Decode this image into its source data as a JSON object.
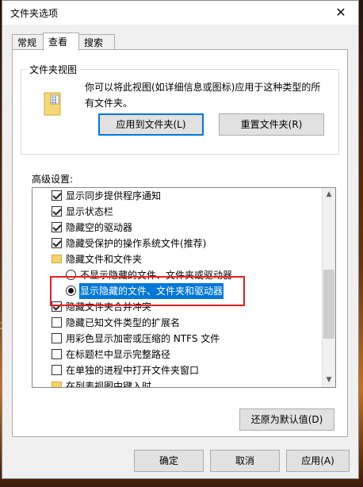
{
  "background": {
    "fragment": "2"
  },
  "window": {
    "title": "文件夹选项",
    "close_label": "✕"
  },
  "tabs": [
    {
      "label": "常规"
    },
    {
      "label": "查看"
    },
    {
      "label": "搜索"
    }
  ],
  "folder_views": {
    "group_label": "文件夹视图",
    "description": "你可以将此视图(如详细信息或图标)应用于这种类型的所有文件夹。",
    "apply_button": "应用到文件夹(L)",
    "reset_button": "重置文件夹(R)"
  },
  "advanced": {
    "label": "高级设置:",
    "items": [
      {
        "kind": "checkbox",
        "label": "显示同步提供程序通知",
        "checked": true
      },
      {
        "kind": "checkbox",
        "label": "显示状态栏",
        "checked": true
      },
      {
        "kind": "checkbox",
        "label": "隐藏空的驱动器",
        "checked": true
      },
      {
        "kind": "checkbox",
        "label": "隐藏受保护的操作系统文件(推荐)",
        "checked": true
      },
      {
        "kind": "folder",
        "label": "隐藏文件和文件夹"
      },
      {
        "kind": "radio",
        "label": "不显示隐藏的文件、文件夹或驱动器",
        "selected": false
      },
      {
        "kind": "radio",
        "label": "显示隐藏的文件、文件夹和驱动器",
        "selected": true
      },
      {
        "kind": "checkbox",
        "label": "隐藏文件夹合并冲突",
        "checked": true
      },
      {
        "kind": "checkbox",
        "label": "隐藏已知文件类型的扩展名",
        "checked": false
      },
      {
        "kind": "checkbox",
        "label": "用彩色显示加密或压缩的 NTFS 文件",
        "checked": false
      },
      {
        "kind": "checkbox",
        "label": "在标题栏中显示完整路径",
        "checked": false
      },
      {
        "kind": "checkbox",
        "label": "在单独的进程中打开文件夹窗口",
        "checked": false
      },
      {
        "kind": "folder",
        "label": "在列表视图中键入时"
      }
    ],
    "restore_defaults_button": "还原为默认值(D)"
  },
  "footer": {
    "ok": "确定",
    "cancel": "取消",
    "apply": "应用(A)"
  },
  "colors": {
    "selection": "#0078d7",
    "annotation": "#e81c1c",
    "focus_border": "#0078d7"
  }
}
